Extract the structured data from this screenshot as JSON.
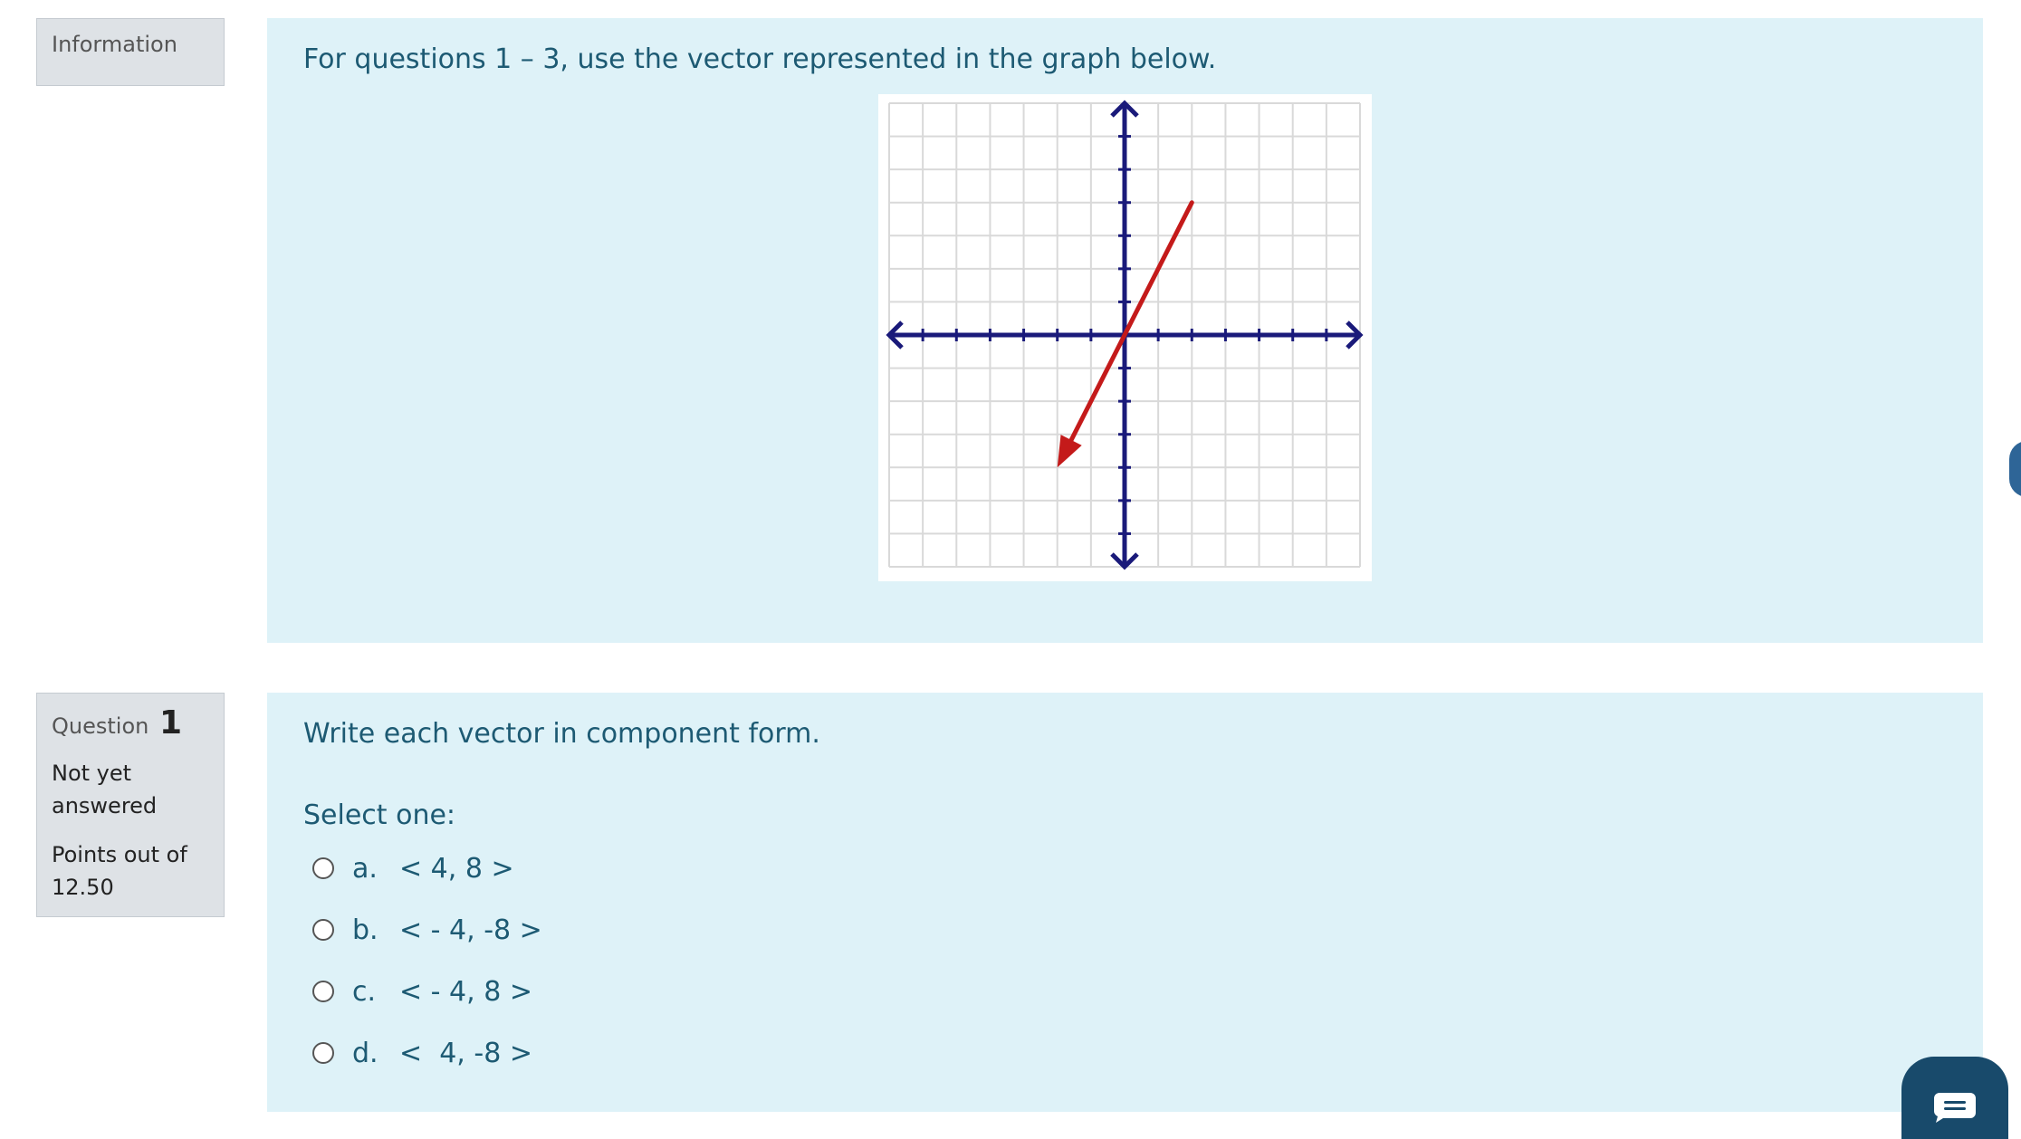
{
  "info": {
    "label": "Information",
    "text": "For questions 1 – 3, use the vector represented in the graph below."
  },
  "question": {
    "label": "Question",
    "number": "1",
    "state": "Not yet answered",
    "grade": "Points out of 12.50",
    "text": "Write each vector in component form.",
    "prompt": "Select one:",
    "answers": [
      {
        "letter": "a.",
        "text": "< 4, 8 >"
      },
      {
        "letter": "b.",
        "text": "< - 4, -8 >"
      },
      {
        "letter": "c.",
        "text": "< - 4, 8 >"
      },
      {
        "letter": "d.",
        "text": "<  4, -8 >"
      }
    ]
  },
  "graph": {
    "vector": {
      "from": [
        2,
        4
      ],
      "to": [
        -2,
        -4
      ]
    },
    "grid_range": [
      -7,
      7
    ],
    "colors": {
      "grid": "#d9d9d9",
      "axes": "#1a1a7a",
      "vector": "#c41a1a"
    }
  },
  "icons": {
    "chat": "chat-bubble-icon",
    "radio": "radio-empty-icon"
  },
  "colors": {
    "panel_bg": "#def2f8",
    "panel_text": "#1d5a73",
    "infobox_bg": "#dee2e6",
    "chat_bg": "#184a6b"
  }
}
